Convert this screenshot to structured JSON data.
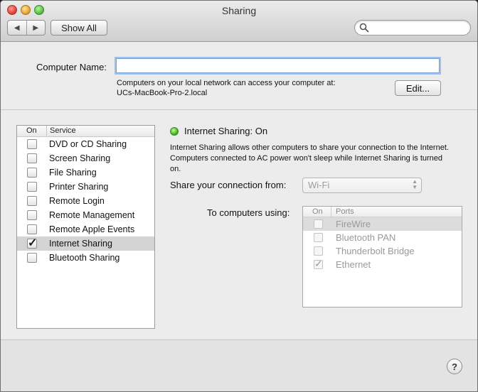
{
  "window": {
    "title": "Sharing"
  },
  "toolbar": {
    "back_glyph": "◀",
    "forward_glyph": "▶",
    "show_all_label": "Show All",
    "search_placeholder": ""
  },
  "computer_name": {
    "label": "Computer Name:",
    "value": "",
    "info_line1": "Computers on your local network can access your computer at:",
    "info_line2": "UCs-MacBook-Pro-2.local",
    "edit_label": "Edit..."
  },
  "services": {
    "col_on": "On",
    "col_service": "Service",
    "items": [
      {
        "label": "DVD or CD Sharing",
        "checked": false
      },
      {
        "label": "Screen Sharing",
        "checked": false
      },
      {
        "label": "File Sharing",
        "checked": false
      },
      {
        "label": "Printer Sharing",
        "checked": false
      },
      {
        "label": "Remote Login",
        "checked": false
      },
      {
        "label": "Remote Management",
        "checked": false
      },
      {
        "label": "Remote Apple Events",
        "checked": false
      },
      {
        "label": "Internet Sharing",
        "checked": true,
        "selected": true
      },
      {
        "label": "Bluetooth Sharing",
        "checked": false
      }
    ],
    "check_glyph": "✓"
  },
  "detail": {
    "status_title": "Internet Sharing: On",
    "status_color": "#48b51f",
    "description": "Internet Sharing allows other computers to share your connection to the Internet. Computers connected to AC power won't sleep while Internet Sharing is turned on.",
    "share_from_label": "Share your connection from:",
    "share_from_value": "Wi-Fi",
    "to_computers_label": "To computers using:",
    "ports_col_on": "On",
    "ports_col_ports": "Ports",
    "ports": [
      {
        "label": "FireWire",
        "checked": false,
        "selected": true
      },
      {
        "label": "Bluetooth PAN",
        "checked": false
      },
      {
        "label": "Thunderbolt Bridge",
        "checked": false
      },
      {
        "label": "Ethernet",
        "checked": true
      }
    ]
  },
  "help_label": "?"
}
